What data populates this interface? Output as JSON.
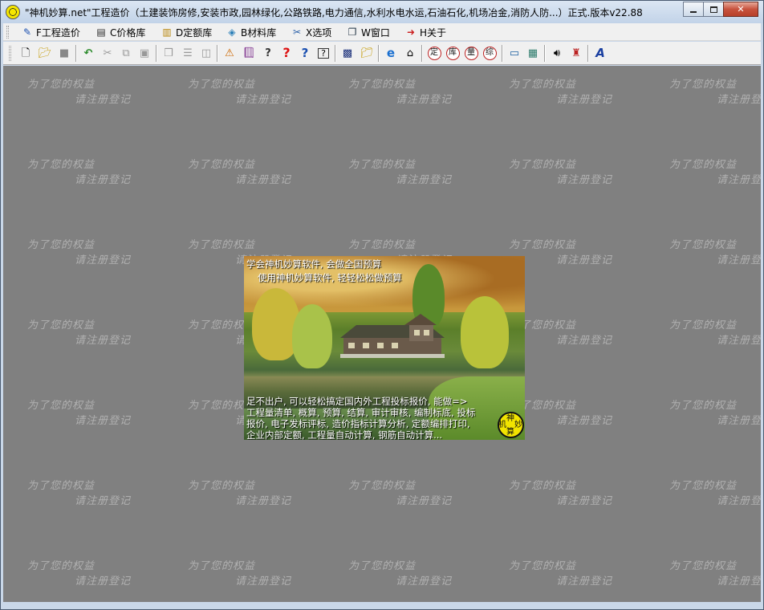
{
  "window": {
    "title": "\"神机妙算.net\"工程造价（土建装饰房修,安装市政,园林绿化,公路铁路,电力通信,水利水电水运,石油石化,机场冶金,消防人防...）正式.版本v22.88"
  },
  "menu": [
    {
      "label": "F工程造价",
      "icon": "pen-chart-icon"
    },
    {
      "label": "C价格库",
      "icon": "price-book-icon"
    },
    {
      "label": "D定额库",
      "icon": "quota-books-icon"
    },
    {
      "label": "B材料库",
      "icon": "material-cube-icon"
    },
    {
      "label": "X选项",
      "icon": "options-tools-icon"
    },
    {
      "label": "W窗口",
      "icon": "windows-icon"
    },
    {
      "label": "H关于",
      "icon": "about-exit-icon"
    }
  ],
  "toolbar": {
    "circle_buttons": [
      "定",
      "库",
      "量",
      "综"
    ]
  },
  "watermark": {
    "line1": "为了您的权益",
    "line2": "请注册登记"
  },
  "splash": {
    "headline1": "学会神机妙算软件, 会做全国预算",
    "headline2": "使用神机妙算软件, 轻轻松松做预算",
    "body": "足不出户, 可以轻松搞定国内外工程投标报价, 能做=> 工程量清单, 概算, 预算, 结算, 审计审核, 编制标底, 投标报价, 电子发标评标, 造价指标计算分析, 定额编排打印, 企业内部定额, 工程量自动计算, 钢筋自动计算...",
    "logo_chars": [
      "神",
      "机",
      "妙",
      "算"
    ]
  }
}
